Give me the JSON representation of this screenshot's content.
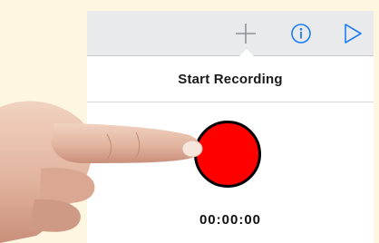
{
  "toolbar": {
    "icons": {
      "add": "plus-icon",
      "info": "info-icon",
      "play": "play-icon"
    },
    "icon_color": "#1c7cf4"
  },
  "popover": {
    "title": "Start Recording",
    "record_button_color": "#ff0000",
    "timer": "00:00:00"
  }
}
